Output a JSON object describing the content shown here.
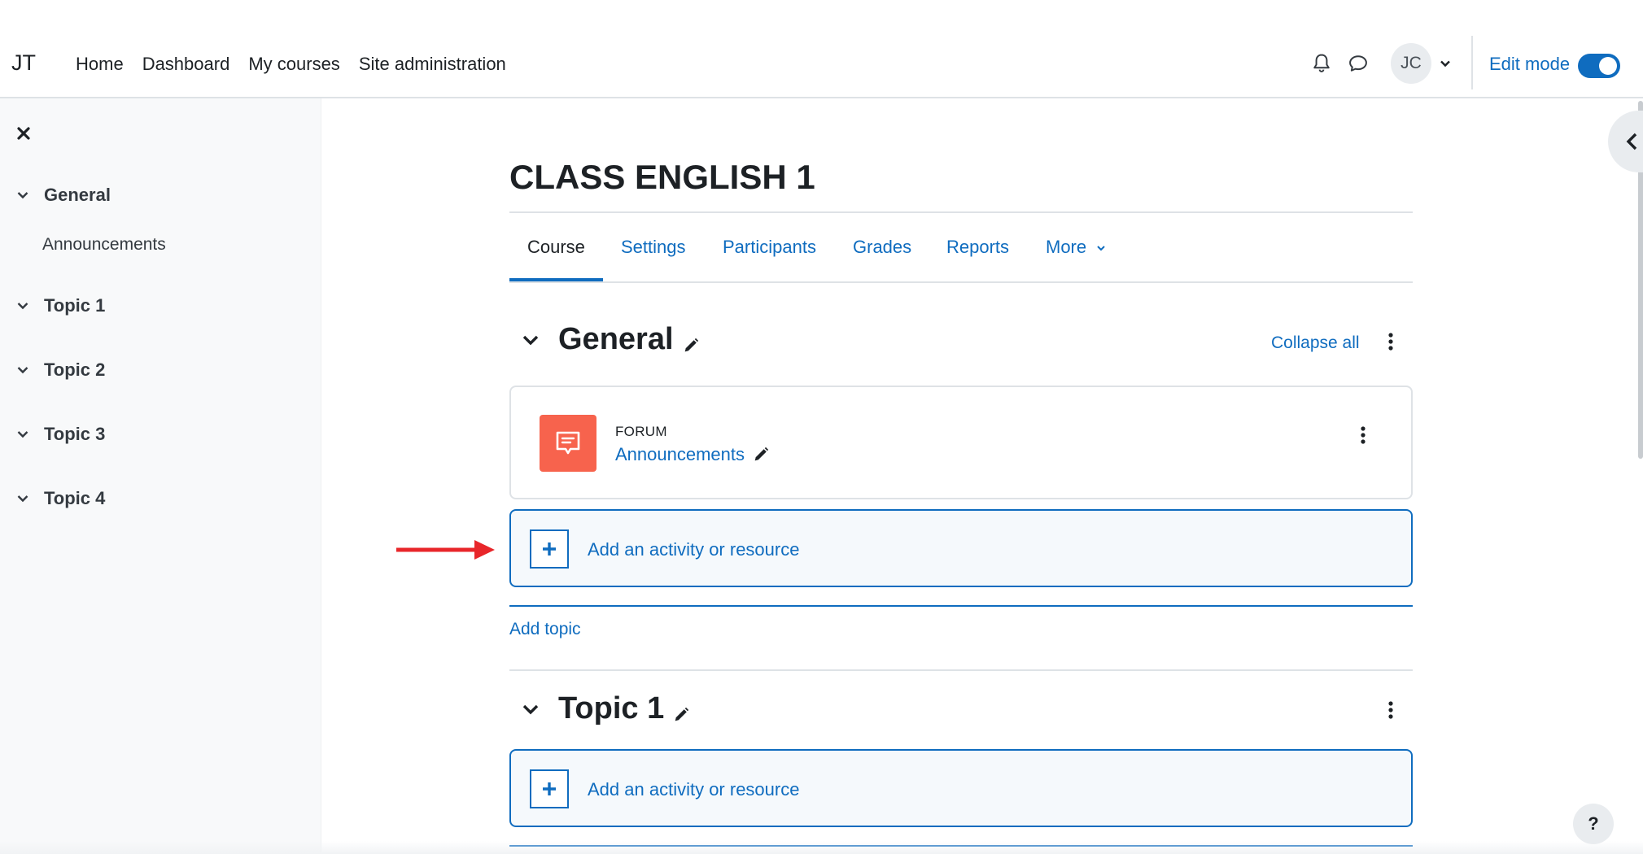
{
  "navbar": {
    "brand": "JT",
    "links": [
      "Home",
      "Dashboard",
      "My courses",
      "Site administration"
    ],
    "avatar_initials": "JC",
    "edit_mode_label": "Edit mode",
    "edit_mode_on": true
  },
  "drawer": {
    "sections": [
      {
        "label": "General",
        "items": [
          "Announcements"
        ]
      },
      {
        "label": "Topic 1",
        "items": []
      },
      {
        "label": "Topic 2",
        "items": []
      },
      {
        "label": "Topic 3",
        "items": []
      },
      {
        "label": "Topic 4",
        "items": []
      }
    ]
  },
  "course": {
    "title": "CLASS ENGLISH 1",
    "tabs": [
      "Course",
      "Settings",
      "Participants",
      "Grades",
      "Reports",
      "More"
    ],
    "active_tab": "Course"
  },
  "sections": [
    {
      "name": "General",
      "collapse_all": "Collapse all",
      "activity": {
        "type": "FORUM",
        "name": "Announcements"
      },
      "add_activity": "Add an activity or resource",
      "add_topic": "Add topic"
    },
    {
      "name": "Topic 1",
      "add_activity": "Add an activity or resource"
    }
  ],
  "help": "?",
  "colors": {
    "accent": "#0f6cbf",
    "forum_icon_bg": "#f7634d",
    "annotation_arrow": "#e8262a"
  }
}
